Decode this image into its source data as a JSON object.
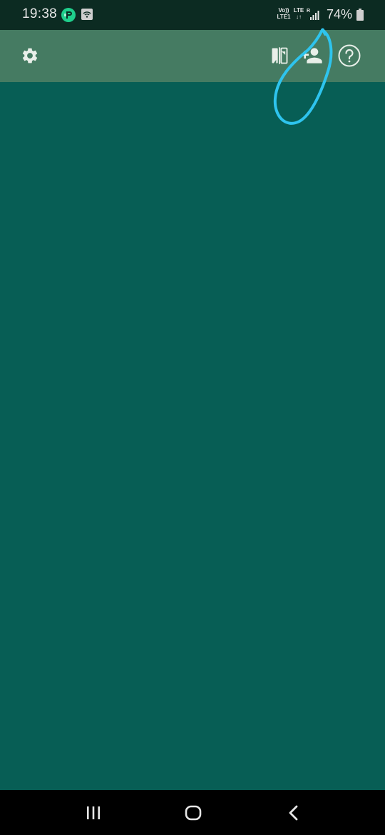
{
  "status_bar": {
    "time": "19:38",
    "network_left_top": "Vo))",
    "network_left_bottom": "LTE1",
    "network_mid_top": "LTE",
    "network_mid_bottom": "↓↑",
    "roaming": "R",
    "battery": "74%"
  },
  "toolbar": {
    "icons": {
      "settings": "gear-icon",
      "switch": "camera-switch-icon",
      "add_contact": "person-add-icon",
      "help": "help-circle-icon"
    }
  },
  "nav_bar": {
    "icons": [
      "recents-icon",
      "home-icon",
      "back-icon"
    ]
  },
  "colors": {
    "status_bar_bg": "#0c2b22",
    "toolbar_bg": "#457b62",
    "main_bg": "#075e55",
    "annotation": "#2ec4ee",
    "nav_bg": "#000000"
  }
}
